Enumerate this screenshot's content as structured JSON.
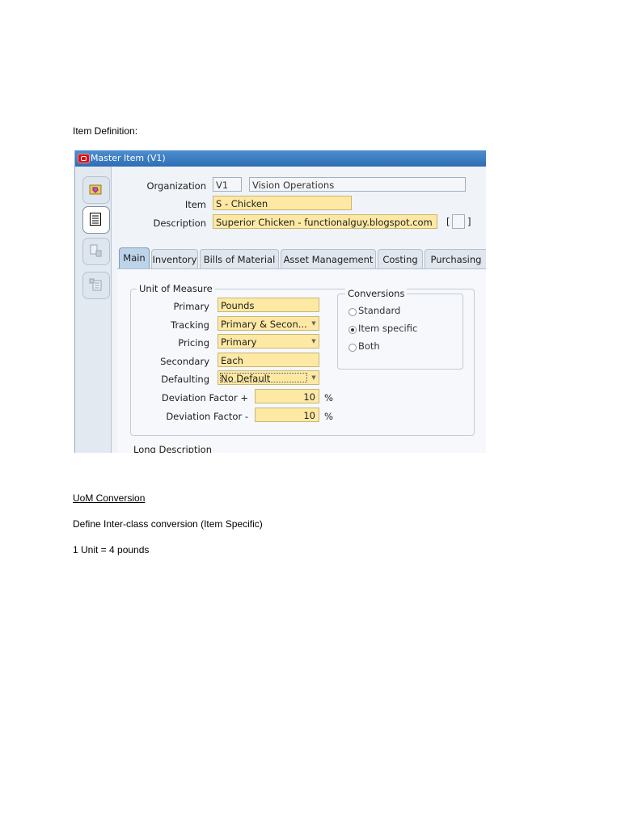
{
  "doc": {
    "heading": "Item Definition:",
    "section_title": "UoM Conversion",
    "line1": "Define Inter-class conversion (Item Specific)",
    "line2": "1 Unit = 4 pounds"
  },
  "window": {
    "title": "Master Item (V1)",
    "header": {
      "organization_label": "Organization",
      "organization_code": "V1",
      "organization_name": "Vision Operations",
      "item_label": "Item",
      "item_value": "S - Chicken",
      "description_label": "Description",
      "description_value": "Superior Chicken - functionalguy.blogspot.com",
      "flex_open": "[",
      "flex_close": "]"
    },
    "left_toolbar": [
      "folder-icon",
      "list-icon",
      "building-icon",
      "tree-list-icon"
    ],
    "tabs": [
      "Main",
      "Inventory",
      "Bills of Material",
      "Asset Management",
      "Costing",
      "Purchasing"
    ],
    "active_tab": "Main",
    "uom": {
      "group_label": "Unit of Measure",
      "primary_label": "Primary",
      "primary_value": "Pounds",
      "tracking_label": "Tracking",
      "tracking_value": "Primary & Secon...",
      "pricing_label": "Pricing",
      "pricing_value": "Primary",
      "secondary_label": "Secondary",
      "secondary_value": "Each",
      "defaulting_label": "Defaulting",
      "defaulting_value": "No Default",
      "dev_plus_label": "Deviation Factor +",
      "dev_plus_value": "10",
      "dev_minus_label": "Deviation Factor -",
      "dev_minus_value": "10",
      "percent": "%"
    },
    "conversions": {
      "group_label": "Conversions",
      "options": [
        "Standard",
        "Item specific",
        "Both"
      ],
      "selected": "Item specific"
    },
    "long_description_label": "Long Description"
  }
}
